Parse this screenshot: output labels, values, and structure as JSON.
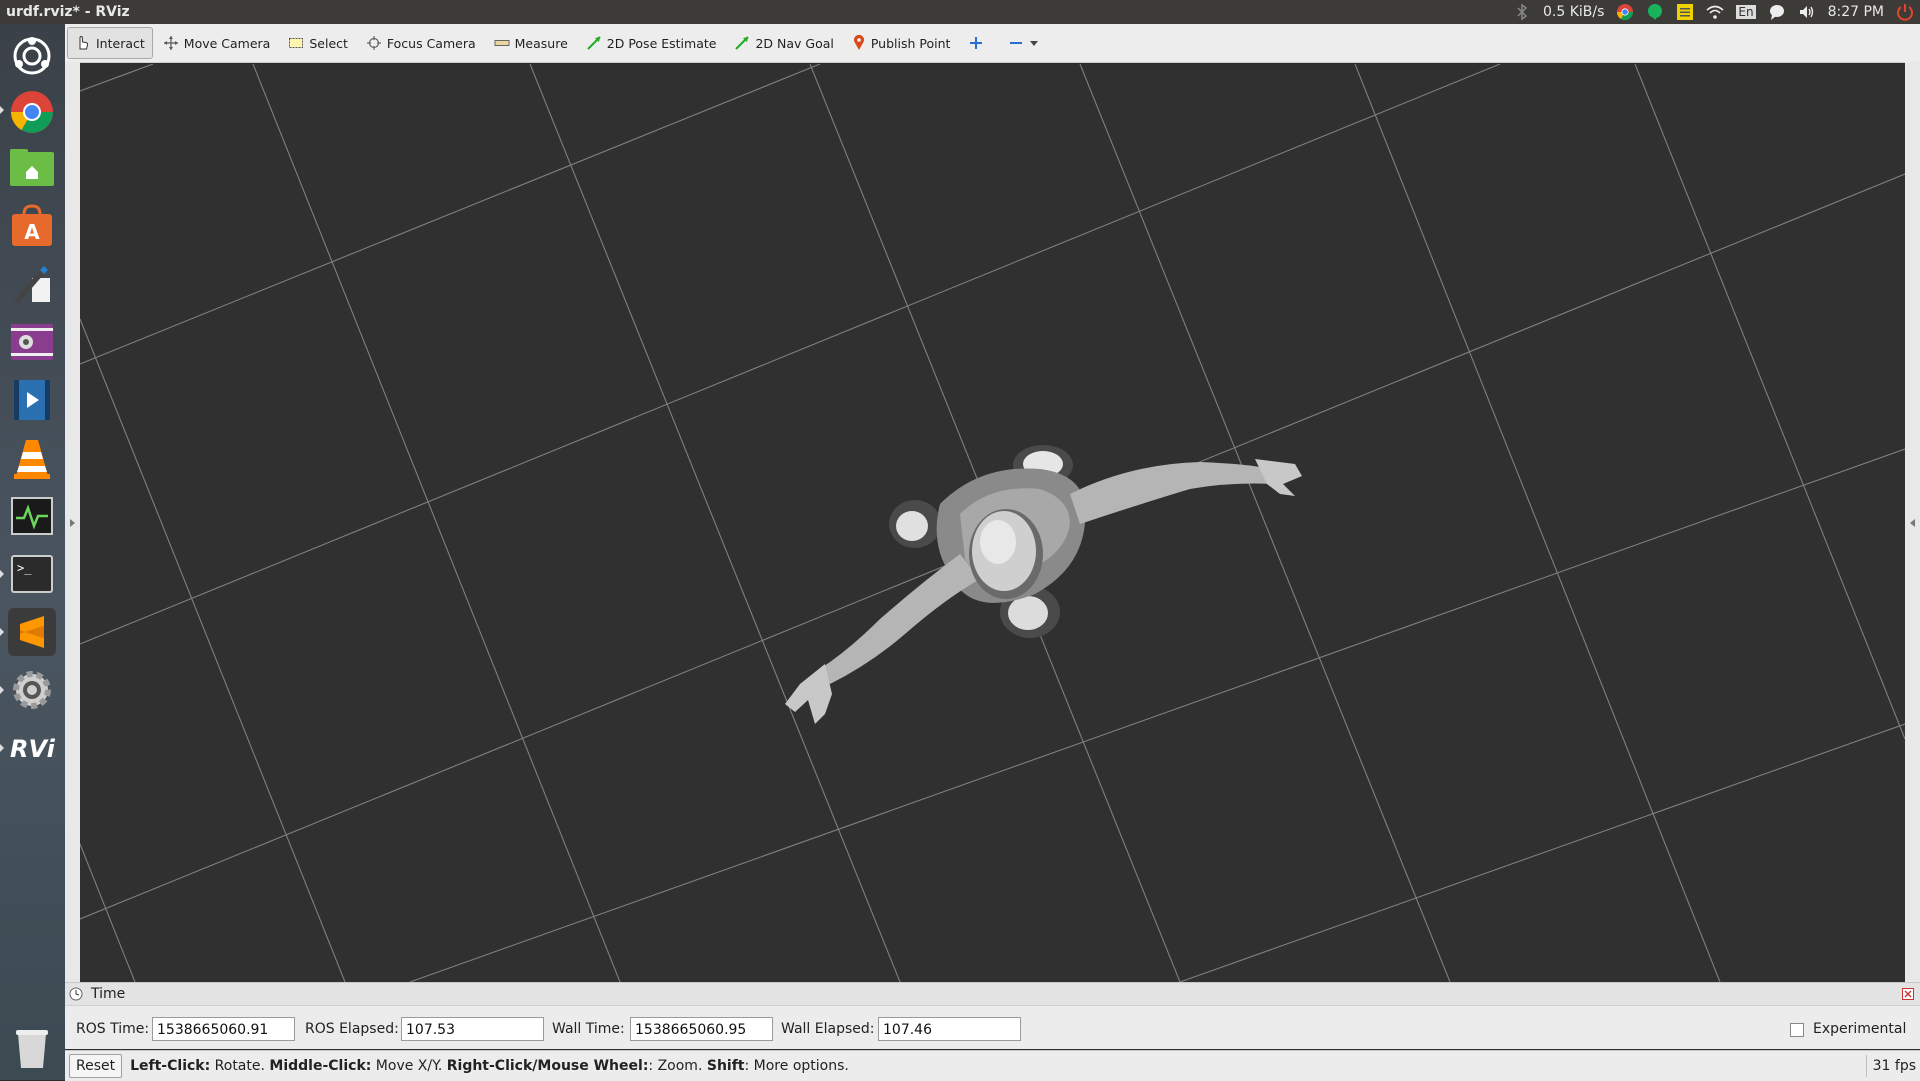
{
  "window": {
    "title": "urdf.rviz* - RViz"
  },
  "tray": {
    "network_speed": "0.5 KiB/s",
    "keyboard_layout": "En",
    "clock": "8:27 PM"
  },
  "launcher": {
    "items": [
      {
        "name": "dash-icon"
      },
      {
        "name": "chrome-icon"
      },
      {
        "name": "files-icon"
      },
      {
        "name": "software-center-icon"
      },
      {
        "name": "text-editor-icon"
      },
      {
        "name": "screenshot-icon"
      },
      {
        "name": "video-icon"
      },
      {
        "name": "vlc-icon"
      },
      {
        "name": "system-monitor-icon"
      },
      {
        "name": "terminal-icon"
      },
      {
        "name": "sublime-text-icon"
      },
      {
        "name": "settings-icon"
      },
      {
        "name": "rviz-icon"
      },
      {
        "name": "trash-icon"
      }
    ]
  },
  "toolbar": {
    "interact": "Interact",
    "move_camera": "Move Camera",
    "select": "Select",
    "focus_camera": "Focus Camera",
    "measure": "Measure",
    "pose_estimate": "2D Pose Estimate",
    "nav_goal": "2D Nav Goal",
    "publish_point": "Publish Point"
  },
  "time_panel": {
    "title": "Time",
    "ros_time_label": "ROS Time:",
    "ros_time": "1538665060.91",
    "ros_elapsed_label": "ROS Elapsed:",
    "ros_elapsed": "107.53",
    "wall_time_label": "Wall Time:",
    "wall_time": "1538665060.95",
    "wall_elapsed_label": "Wall Elapsed:",
    "wall_elapsed": "107.46",
    "experimental_label": "Experimental"
  },
  "status": {
    "reset": "Reset",
    "hint_left_key": "Left-Click:",
    "hint_left": " Rotate. ",
    "hint_middle_key": "Middle-Click:",
    "hint_middle": " Move X/Y. ",
    "hint_right_key": "Right-Click/Mouse Wheel:",
    "hint_right": ": Zoom. ",
    "hint_shift_key": "Shift",
    "hint_shift": ": More options.",
    "fps": "31 fps"
  },
  "colors": {
    "viewport_bg": "#303030",
    "grid": "#a0a0a0",
    "panel_bg": "#3c3b37",
    "accent_orange": "#dd4814"
  }
}
